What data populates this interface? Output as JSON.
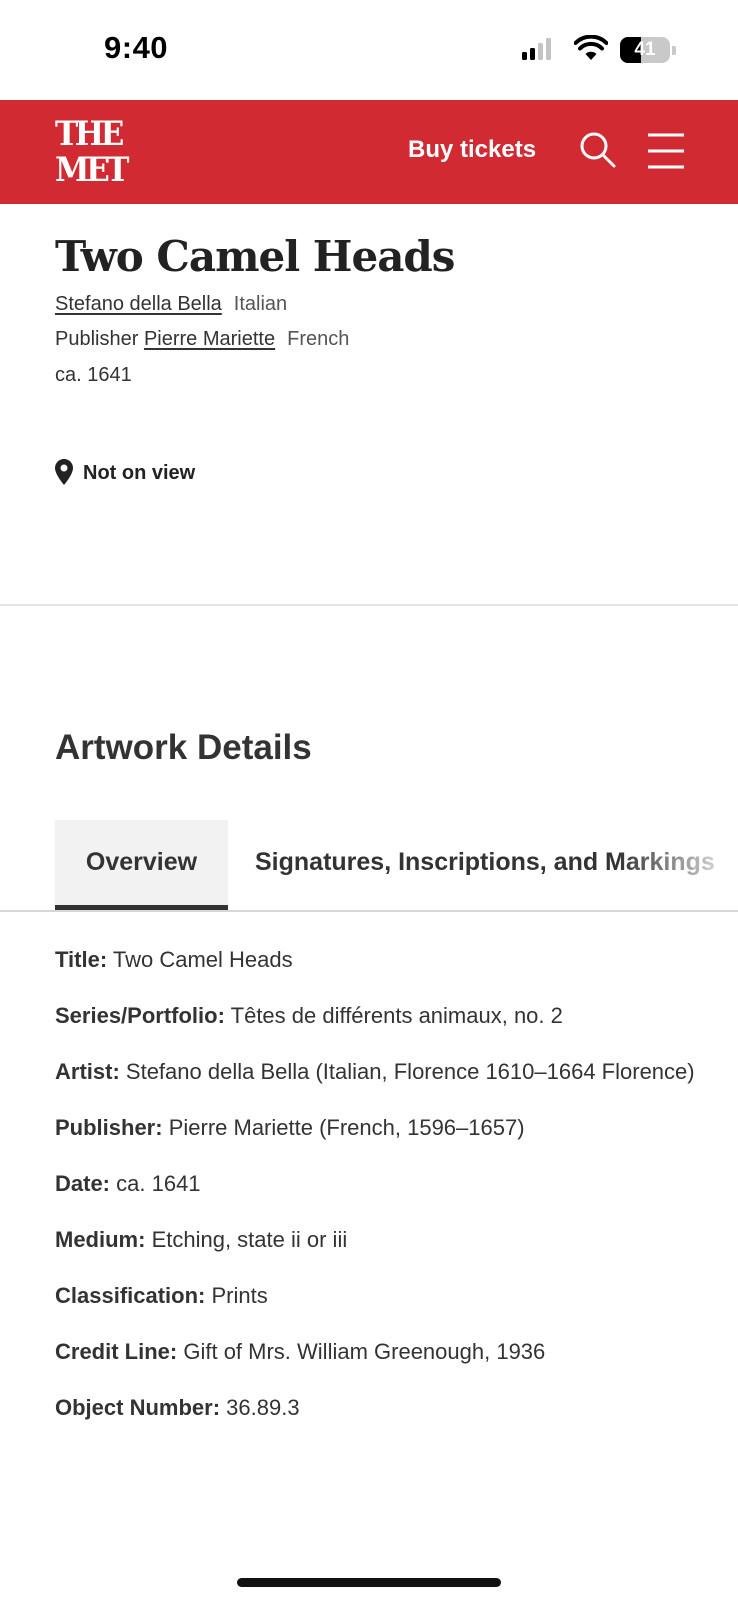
{
  "status_bar": {
    "time": "9:40",
    "battery_percent": "41",
    "battery_level": 0.41
  },
  "header": {
    "logo_line1": "THE",
    "logo_line2": "MET",
    "buy_tickets_label": "Buy tickets",
    "search_icon": "search-icon",
    "menu_icon": "hamburger-menu-icon",
    "brand_color": "#d12a33"
  },
  "artwork": {
    "title": "Two Camel Heads",
    "artist_name": "Stefano della Bella",
    "artist_nationality": "Italian",
    "publisher_prefix": "Publisher",
    "publisher_name": "Pierre Mariette",
    "publisher_nationality": "French",
    "date": "ca. 1641",
    "view_status": "Not on view"
  },
  "details_section": {
    "heading": "Artwork Details",
    "tabs": [
      {
        "label": "Overview",
        "selected": true
      },
      {
        "label": "Signatures, Inscriptions, and Markings",
        "selected": false
      }
    ],
    "rows": [
      {
        "label": "Title:",
        "value": "Two Camel Heads"
      },
      {
        "label": "Series/Portfolio:",
        "value": "Têtes de différents animaux, no. 2"
      },
      {
        "label": "Artist:",
        "value": "Stefano della Bella (Italian, Florence 1610–1664 Florence)"
      },
      {
        "label": "Publisher:",
        "value": "Pierre Mariette (French, 1596–1657)"
      },
      {
        "label": "Date:",
        "value": "ca. 1641"
      },
      {
        "label": "Medium:",
        "value": "Etching, state ii or iii"
      },
      {
        "label": "Classification:",
        "value": "Prints"
      },
      {
        "label": "Credit Line:",
        "value": "Gift of Mrs. William Greenough, 1936"
      },
      {
        "label": "Object Number:",
        "value": "36.89.3"
      }
    ]
  }
}
